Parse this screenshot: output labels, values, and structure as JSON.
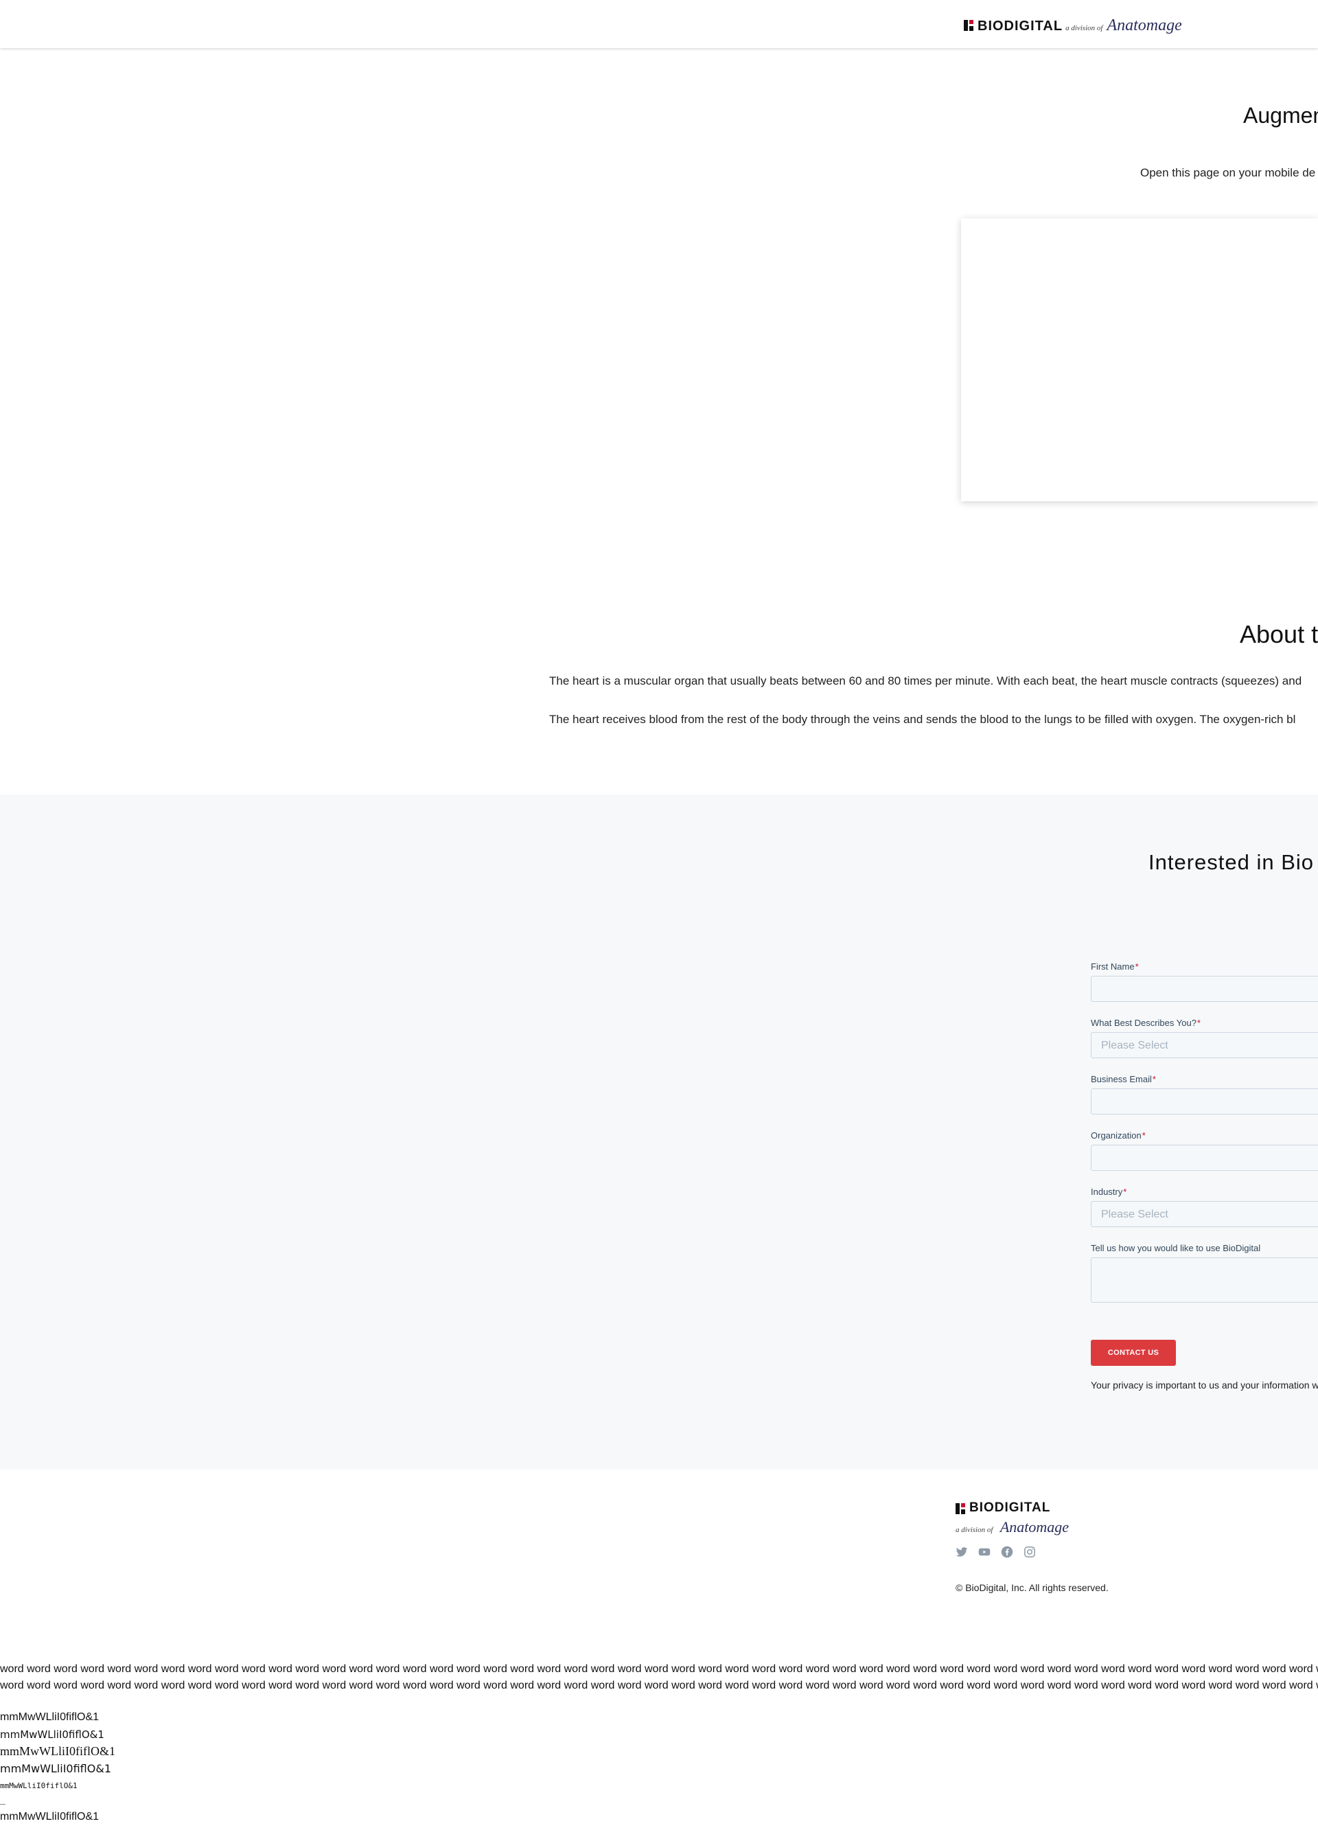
{
  "header": {
    "brand": "BIODIGITAL",
    "division": "a division of",
    "parent": "Anatomage"
  },
  "ar": {
    "title": "Augmen",
    "subtitle": "Open this page on your mobile de"
  },
  "about": {
    "title": "About t",
    "paragraph1": "The heart is a muscular organ that usually beats between 60 and 80 times per minute. With each beat, the heart muscle contracts (squeezes) and",
    "paragraph2": "The heart receives blood from the rest of the body through the veins and sends the blood to the lungs to be filled with oxygen. The oxygen-rich bl"
  },
  "contact": {
    "title": "Interested in Bio",
    "required_mark": "*",
    "fields": {
      "first_name": {
        "label": "First Name"
      },
      "describes": {
        "label": "What Best Describes You?",
        "placeholder": "Please Select"
      },
      "email": {
        "label": "Business Email"
      },
      "organization": {
        "label": "Organization"
      },
      "industry": {
        "label": "Industry",
        "placeholder": "Please Select"
      },
      "usage": {
        "label": "Tell us how you would like to use BioDigital"
      }
    },
    "submit_label": "CONTACT US",
    "privacy": "Your privacy is important to us and your information w"
  },
  "footer": {
    "brand": "BIODIGITAL",
    "division": "a division of",
    "parent": "Anatomage",
    "social": [
      "twitter-icon",
      "youtube-icon",
      "facebook-icon",
      "instagram-icon"
    ],
    "copyright": "© BioDigital, Inc. All rights reserved."
  },
  "test": {
    "word_line": "word word word word word word word word word word word word word word word word word word word word word word word word word word word word word word word word word word word word word word word word word word word word word word word word word word word word wo",
    "glyphs": "mmMwWLliI0fiflO&1"
  },
  "colors": {
    "accent": "#dc3b3e",
    "brand_red": "#c8102e",
    "band_bg": "#f6f8f9",
    "field_bg": "#f5f8fa",
    "icon_gray": "#8e9aa6"
  }
}
